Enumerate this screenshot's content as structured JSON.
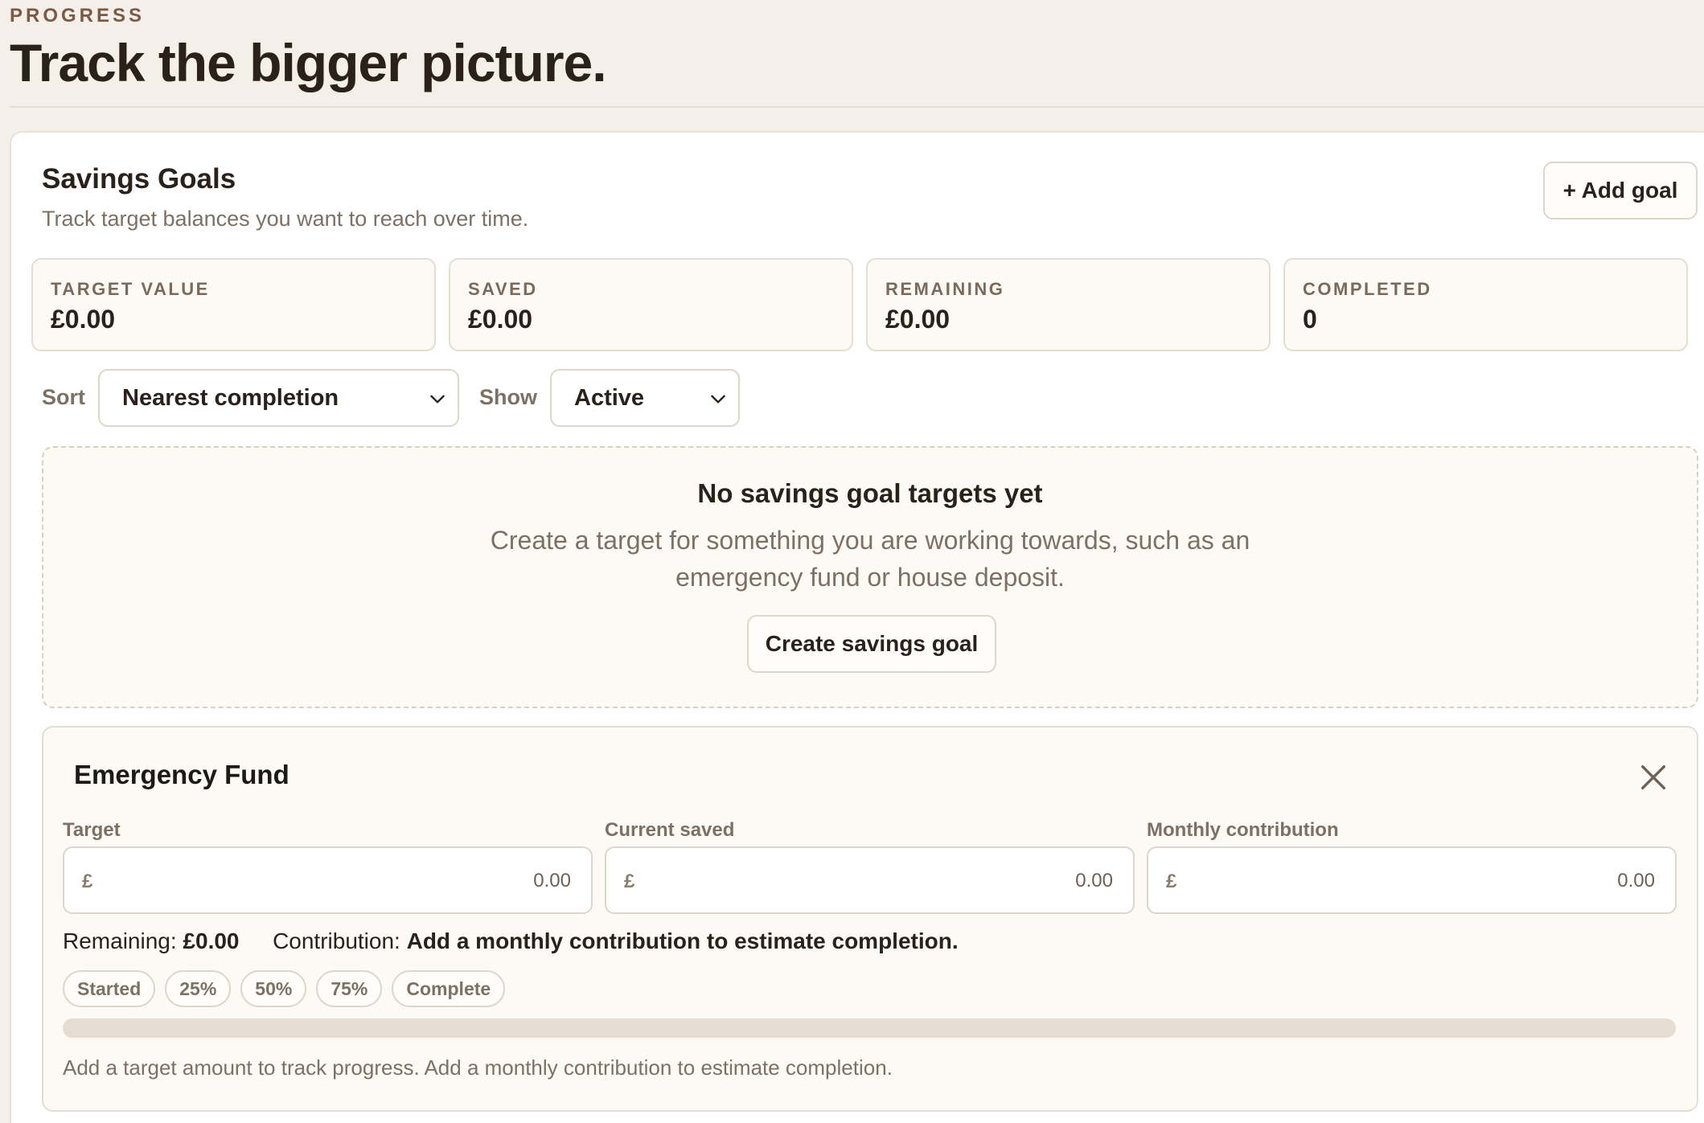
{
  "header": {
    "eyebrow": "PROGRESS",
    "title": "Track the bigger picture."
  },
  "savings": {
    "title": "Savings Goals",
    "subtitle": "Track target balances you want to reach over time.",
    "add_goal_label": "+ Add goal",
    "stats": [
      {
        "label": "TARGET VALUE",
        "value": "£0.00"
      },
      {
        "label": "SAVED",
        "value": "£0.00"
      },
      {
        "label": "REMAINING",
        "value": "£0.00"
      },
      {
        "label": "COMPLETED",
        "value": "0"
      }
    ],
    "sort": {
      "label": "Sort",
      "selected": "Nearest completion"
    },
    "show": {
      "label": "Show",
      "selected": "Active"
    },
    "empty_state": {
      "title": "No savings goal targets yet",
      "text": "Create a target for something you are working towards, such as an emergency fund or house deposit.",
      "button_label": "Create savings goal"
    }
  },
  "goal": {
    "name": "Emergency Fund",
    "currency_symbol": "£",
    "fields": [
      {
        "label": "Target",
        "placeholder": "0.00"
      },
      {
        "label": "Current saved",
        "placeholder": "0.00"
      },
      {
        "label": "Monthly contribution",
        "placeholder": "0.00"
      }
    ],
    "remaining_label": "Remaining:",
    "remaining_value": "£0.00",
    "contribution_label": "Contribution:",
    "contribution_value": "Add a monthly contribution to estimate completion.",
    "milestones": [
      "Started",
      "25%",
      "50%",
      "75%",
      "Complete"
    ],
    "progress_percent": 0,
    "hint": "Add a target amount to track progress. Add a monthly contribution to estimate completion."
  },
  "colors": {
    "page_bg": "#f4efe8",
    "accent_brown": "#7a5a45",
    "progress_track": "#e5ddd2"
  }
}
